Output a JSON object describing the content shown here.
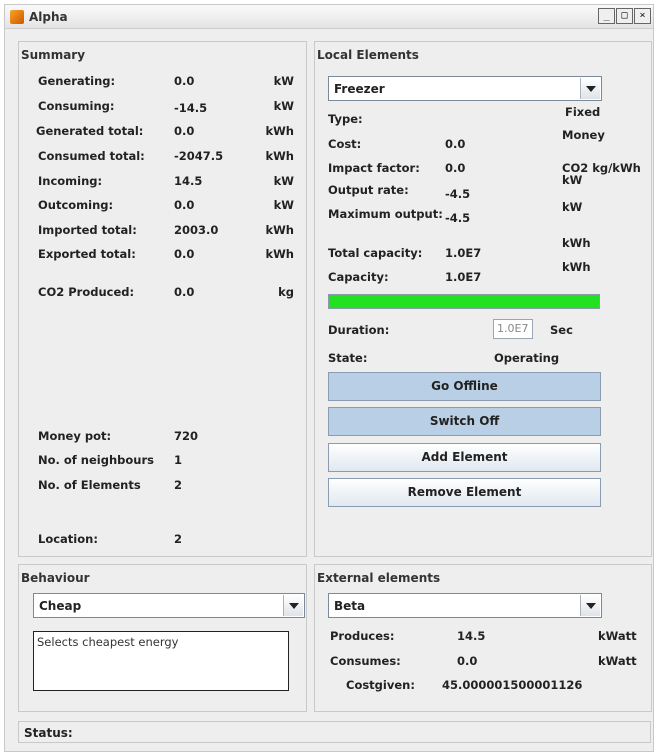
{
  "window": {
    "title": "Alpha",
    "buttons": [
      "_",
      "□",
      "×"
    ]
  },
  "summary": {
    "title": "Summary",
    "rows": [
      {
        "label": "Generating:",
        "value": "0.0",
        "unit": "kW"
      },
      {
        "label": "Consuming:",
        "value": "-14.5",
        "unit": "kW"
      },
      {
        "label": "Generated total:",
        "value": "0.0",
        "unit": "kWh"
      },
      {
        "label": "Consumed total:",
        "value": "-2047.5",
        "unit": "kWh"
      },
      {
        "label": "Incoming:",
        "value": "14.5",
        "unit": "kW"
      },
      {
        "label": "Outcoming:",
        "value": "0.0",
        "unit": "kW"
      },
      {
        "label": "Imported total:",
        "value": "2003.0",
        "unit": "kWh"
      },
      {
        "label": "Exported total:",
        "value": "0.0",
        "unit": "kWh"
      },
      {
        "label": "CO2 Produced:",
        "value": "0.0",
        "unit": "kg"
      }
    ],
    "money_pot_label": "Money pot:",
    "money_pot_value": "720",
    "neighbours_label": "No. of neighbours",
    "neighbours_value": "1",
    "elements_label": "No. of Elements",
    "elements_value": "2",
    "location_label": "Location:",
    "location_value": "2"
  },
  "local": {
    "title": "Local Elements",
    "selected": "Freezer",
    "type_label": "Type:",
    "type_value": "Fixed",
    "cost_label": "Cost:",
    "cost_value": "0.0",
    "cost_unit": "Money",
    "impact_label": "Impact factor:",
    "impact_value": "0.0",
    "impact_unit": "CO2 kg/kWh",
    "output_rate_label": "Output rate:",
    "output_rate_value": "-4.5",
    "output_rate_unit": "kW",
    "max_output_label": "Maximum output:",
    "max_output_value": "-4.5",
    "max_output_unit": "kW",
    "total_capacity_label": "Total capacity:",
    "total_capacity_value": "1.0E7",
    "total_capacity_unit": "kWh",
    "capacity_label": "Capacity:",
    "capacity_value": "1.0E7",
    "capacity_unit": "kWh",
    "capacity_fill": 1.0,
    "progress_color": "#22e022",
    "duration_label": "Duration:",
    "duration_value": "1.0E7",
    "duration_unit": "Sec",
    "state_label": "State:",
    "state_value": "Operating",
    "buttons": {
      "go_offline": "Go Offline",
      "switch_off": "Switch Off",
      "add": "Add Element",
      "remove": "Remove Element"
    }
  },
  "behaviour": {
    "title": "Behaviour",
    "selected": "Cheap",
    "description": "Selects cheapest energy"
  },
  "external": {
    "title": "External elements",
    "selected": "Beta",
    "produces_label": "Produces:",
    "produces_value": "14.5",
    "produces_unit": "kWatt",
    "consumes_label": "Consumes:",
    "consumes_value": "0.0",
    "consumes_unit": "kWatt",
    "costgiven_label": "Costgiven:",
    "costgiven_value": "45.000001500001126"
  },
  "status": {
    "label": "Status:"
  }
}
